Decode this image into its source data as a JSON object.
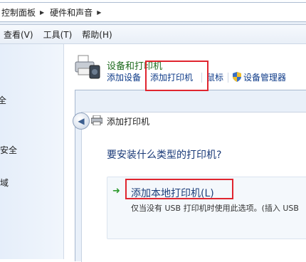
{
  "breadcrumb": {
    "items": [
      "控制面板",
      "硬件和声音"
    ],
    "separator": "▶"
  },
  "menu": [
    "查看(V)",
    "工具(T)",
    "帮助(H)"
  ],
  "nav": [
    "全",
    "域"
  ],
  "nav_security": "安全",
  "devices": {
    "title": "设备和打印机",
    "toolbar": [
      "添加设备",
      "添加打印机",
      "鼠标",
      "设备管理器"
    ]
  },
  "wizard": {
    "title": "添加打印机",
    "question": "要安装什么类型的打印机?",
    "option_title": "添加本地打印机(L)",
    "option_desc": "仅当没有 USB 打印机时使用此选项。(插入 USB"
  },
  "colors": {
    "highlight": "#e0252f",
    "title_green": "#1e6b1e",
    "link_blue": "#0d3a88"
  }
}
